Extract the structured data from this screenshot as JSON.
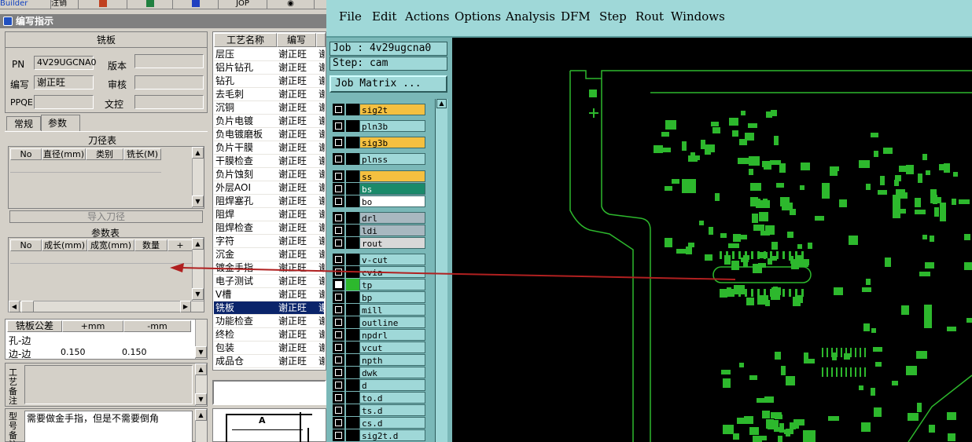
{
  "top_toolbar": {
    "builder": "Builder",
    "note": "注销",
    "jop": "JOP"
  },
  "left_window": {
    "title": "编写指示",
    "section_title": "铣板",
    "pn_label": "PN",
    "pn_value": "4V29UGCNA0",
    "version_label": "版本",
    "author_label": "编写",
    "author_value": "谢正旺",
    "review_label": "审核",
    "ppqe_label": "PPQE",
    "doc_label": "文控",
    "tabs": [
      "常规",
      "参数"
    ],
    "tool_table": {
      "title": "刀径表",
      "headers": [
        "No",
        "直径(mm)",
        "类别",
        "铣长(M)"
      ]
    },
    "import_btn": "导入刀径",
    "param_table": {
      "title": "参数表",
      "headers": [
        "No",
        "成长(mm)",
        "成宽(mm)",
        "数量",
        "+"
      ]
    },
    "tolerance": {
      "headers": [
        "铣板公差",
        "+mm",
        "-mm"
      ],
      "rows": [
        [
          "孔-边",
          "",
          ""
        ],
        [
          "边-边",
          "0.150",
          "0.150"
        ]
      ]
    },
    "process_note_label": "工艺备注",
    "type_note_label": "型号备注",
    "type_note_value": "需要做金手指，但是不需要倒角",
    "process_headers": [
      "工艺名称",
      "编写"
    ],
    "process_rows": [
      [
        "层压",
        "谢正旺"
      ],
      [
        "铝片钻孔",
        "谢正旺"
      ],
      [
        "钻孔",
        "谢正旺"
      ],
      [
        "去毛刺",
        "谢正旺"
      ],
      [
        "沉铜",
        "谢正旺"
      ],
      [
        "负片电镀",
        "谢正旺"
      ],
      [
        "负电镀磨板",
        "谢正旺"
      ],
      [
        "负片干膜",
        "谢正旺"
      ],
      [
        "干膜检查",
        "谢正旺"
      ],
      [
        "负片蚀刻",
        "谢正旺"
      ],
      [
        "外层AOI",
        "谢正旺"
      ],
      [
        "阻焊塞孔",
        "谢正旺"
      ],
      [
        "阻焊",
        "谢正旺"
      ],
      [
        "阻焊检查",
        "谢正旺"
      ],
      [
        "字符",
        "谢正旺"
      ],
      [
        "沉金",
        "谢正旺"
      ],
      [
        "镀金手指",
        "谢正旺"
      ],
      [
        "电子测试",
        "谢正旺"
      ],
      [
        "V槽",
        "谢正旺"
      ],
      [
        "铣板",
        "谢正旺"
      ],
      [
        "功能检查",
        "谢正旺"
      ],
      [
        "终检",
        "谢正旺"
      ],
      [
        "包装",
        "谢正旺"
      ],
      [
        "成品仓",
        "谢正旺"
      ]
    ],
    "selected_process": 19,
    "drawing_label": "A"
  },
  "right_window": {
    "menu": [
      "File",
      "Edit",
      "Actions",
      "Options",
      "Analysis",
      "DFM",
      "Step",
      "Rout",
      "Windows"
    ],
    "job": "Job : 4v29ugcna0",
    "step": "Step: cam",
    "matrix_btn": "Job Matrix ...",
    "layers": [
      {
        "name": "sig2t",
        "color": "#f5c040"
      },
      {
        "name": "pln3b",
        "color": "#9fd8d8"
      },
      {
        "name": "sig3b",
        "color": "#f5c040"
      },
      {
        "name": "plnss",
        "color": "#9fd8d8"
      },
      {
        "name": "ss",
        "color": "#f5c040"
      },
      {
        "name": "bs",
        "color": "#1a8a6a"
      },
      {
        "name": "bo",
        "color": "#ffffff"
      },
      {
        "name": "drl",
        "color": "#a8b8c0"
      },
      {
        "name": "ldi",
        "color": "#a8b8c0"
      },
      {
        "name": "rout",
        "color": "#d8d8d8"
      },
      {
        "name": "v-cut",
        "color": "#9fd8d8"
      },
      {
        "name": "cvia",
        "color": "#9fd8d8"
      },
      {
        "name": "tp",
        "color": "#9fd8d8"
      },
      {
        "name": "bp",
        "color": "#9fd8d8"
      },
      {
        "name": "mill",
        "color": "#9fd8d8"
      },
      {
        "name": "outline",
        "color": "#9fd8d8"
      },
      {
        "name": "npdrl",
        "color": "#9fd8d8"
      },
      {
        "name": "vcut",
        "color": "#9fd8d8"
      },
      {
        "name": "npth",
        "color": "#9fd8d8"
      },
      {
        "name": "dwk",
        "color": "#9fd8d8"
      },
      {
        "name": "d",
        "color": "#9fd8d8"
      },
      {
        "name": "to.d",
        "color": "#9fd8d8"
      },
      {
        "name": "ts.d",
        "color": "#9fd8d8"
      },
      {
        "name": "cs.d",
        "color": "#9fd8d8"
      },
      {
        "name": "sig2t.d",
        "color": "#9fd8d8"
      }
    ],
    "active_layer": "tp",
    "pcb_color": "#2db82d"
  }
}
